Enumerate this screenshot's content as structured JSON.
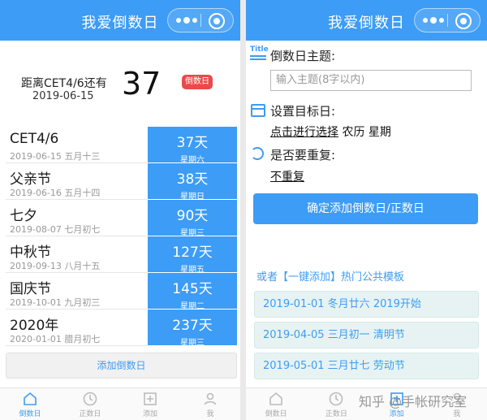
{
  "left": {
    "nav_title": "我爱倒数日",
    "hero": {
      "name": "距离CET4/6还有",
      "date": "2019-06-15",
      "days": "37",
      "tag": "倒数日"
    },
    "events": [
      {
        "name": "CET4/6",
        "date": "2019-06-15 五月十三",
        "days": "37天",
        "weekday": "星期六"
      },
      {
        "name": "父亲节",
        "date": "2019-06-16 五月十四",
        "days": "38天",
        "weekday": "星期日"
      },
      {
        "name": "七夕",
        "date": "2019-08-07 七月初七",
        "days": "90天",
        "weekday": "星期三"
      },
      {
        "name": "中秋节",
        "date": "2019-09-13 八月十五",
        "days": "127天",
        "weekday": "星期五"
      },
      {
        "name": "国庆节",
        "date": "2019-10-01 九月初三",
        "days": "145天",
        "weekday": "星期二"
      },
      {
        "name": "2020年",
        "date": "2020-01-01 腊月初七",
        "days": "237天",
        "weekday": "星期三"
      }
    ],
    "add_label": "添加倒数日",
    "tabs": [
      "倒数日",
      "正数日",
      "添加",
      "我"
    ]
  },
  "right": {
    "nav_title": "我爱倒数日",
    "title_icon": "Title",
    "topic_label": "倒数日主题:",
    "topic_placeholder": "输入主题(8字以内)",
    "date_label": "设置目标日:",
    "date_link": "点击进行选择",
    "lunar": "农历",
    "weekday": "星期",
    "repeat_label": "是否要重复:",
    "repeat_value": "不重复",
    "confirm": "确定添加倒数日/正数日",
    "template_header": "或者【一键添加】热门公共模板",
    "templates": [
      "2019-01-01 冬月廿六 2019开始",
      "2019-04-05 三月初一 清明节",
      "2019-05-01 三月廿七 劳动节"
    ],
    "tabs": [
      "倒数日",
      "正数日",
      "添加",
      "我"
    ]
  },
  "watermark": "知乎 @手帐研究室",
  "colors": {
    "primary": "#3d9cf5",
    "tag_red": "#ea4a4a",
    "template_bg": "#e7f3f3"
  }
}
